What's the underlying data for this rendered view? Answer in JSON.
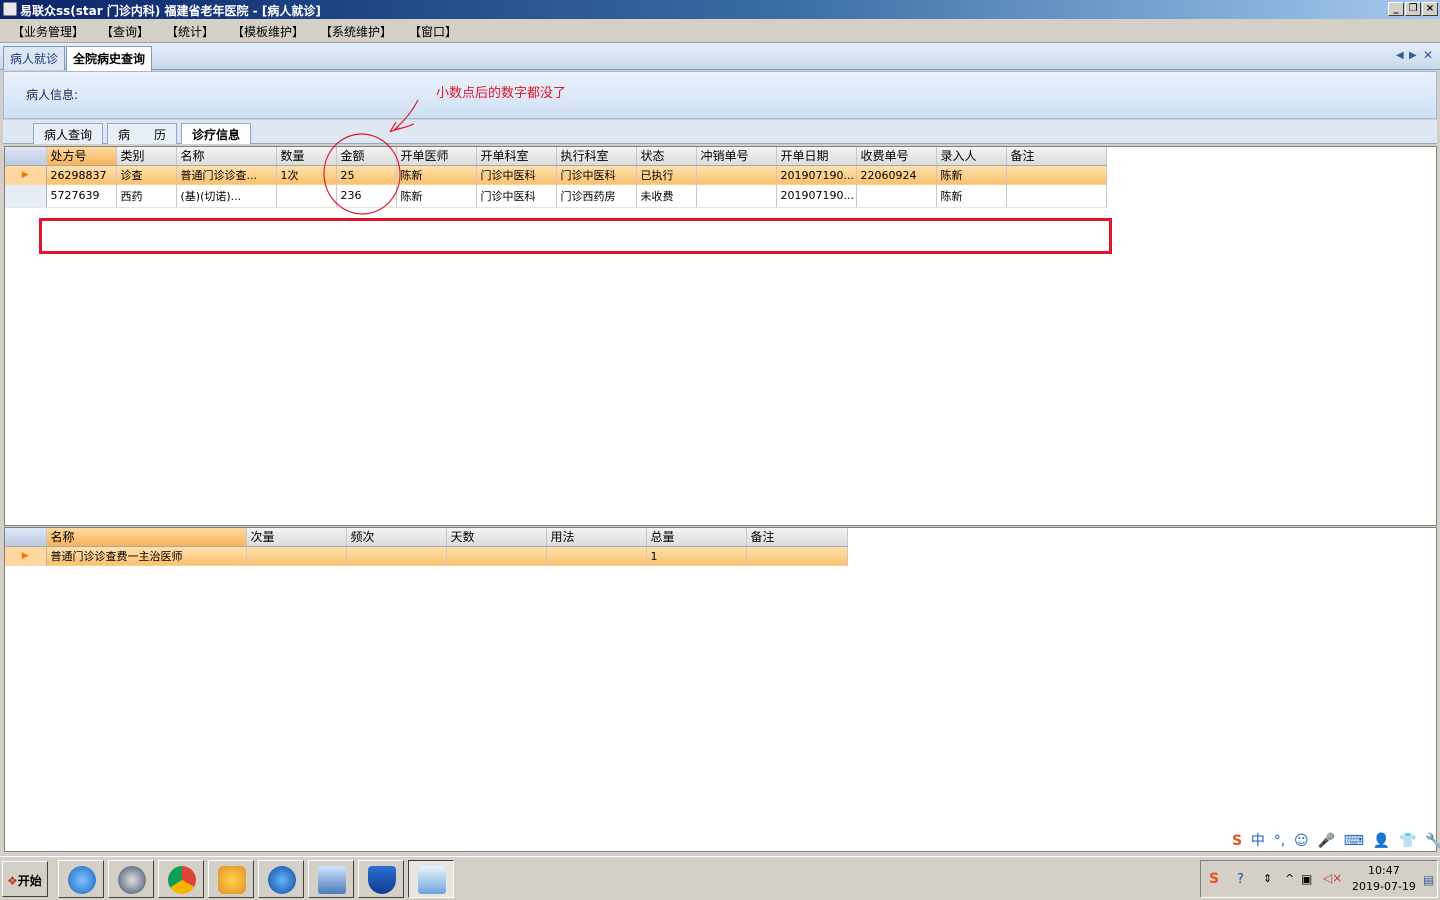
{
  "window": {
    "title": "易联众ss(star 门诊内科) 福建省老年医院 - [病人就诊]"
  },
  "menu": [
    "【业务管理】",
    "【查询】",
    "【统计】",
    "【模板维护】",
    "【系统维护】",
    "【窗口】"
  ],
  "doc_tabs": [
    "病人就诊",
    "全院病史查询"
  ],
  "patient_info_label": "病人信息:",
  "annotation_text": "小数点后的数字都没了",
  "inner_tabs": [
    "病人查询",
    "病　　历",
    "诊疗信息"
  ],
  "orders_grid": {
    "columns": [
      "处方号",
      "类别",
      "名称",
      "数量",
      "金额",
      "开单医师",
      "开单科室",
      "执行科室",
      "状态",
      "冲销单号",
      "开单日期",
      "收费单号",
      "录入人",
      "备注"
    ],
    "rows": [
      [
        "26298837",
        "诊查",
        "普通门诊诊查...",
        "1次",
        "25",
        "陈新",
        "门诊中医科",
        "门诊中医科",
        "已执行",
        "",
        "201907190...",
        "22060924",
        "陈新",
        ""
      ],
      [
        "5727639",
        "西药",
        "(基)(切诺)...",
        "",
        "236",
        "陈新",
        "门诊中医科",
        "门诊西药房",
        "未收费",
        "",
        "201907190...",
        "",
        "陈新",
        ""
      ]
    ]
  },
  "detail_grid": {
    "columns": [
      "名称",
      "次量",
      "频次",
      "天数",
      "用法",
      "总量",
      "备注"
    ],
    "rows": [
      [
        "普通门诊诊查费一主治医师",
        "",
        "",
        "",
        "",
        "1",
        ""
      ]
    ]
  },
  "ime_toolbar": [
    "S",
    "中",
    "°,",
    "☺",
    "🎤",
    "⌨",
    "👤",
    "👕",
    "🔧"
  ],
  "taskbar": {
    "start_label": "开始",
    "tray": {
      "time": "10:47",
      "date": "2019-07-19"
    }
  },
  "colors": {
    "title_bar": "#0a246a",
    "selected_row": "#f9c06e",
    "annotation_red": "#e0142a"
  }
}
